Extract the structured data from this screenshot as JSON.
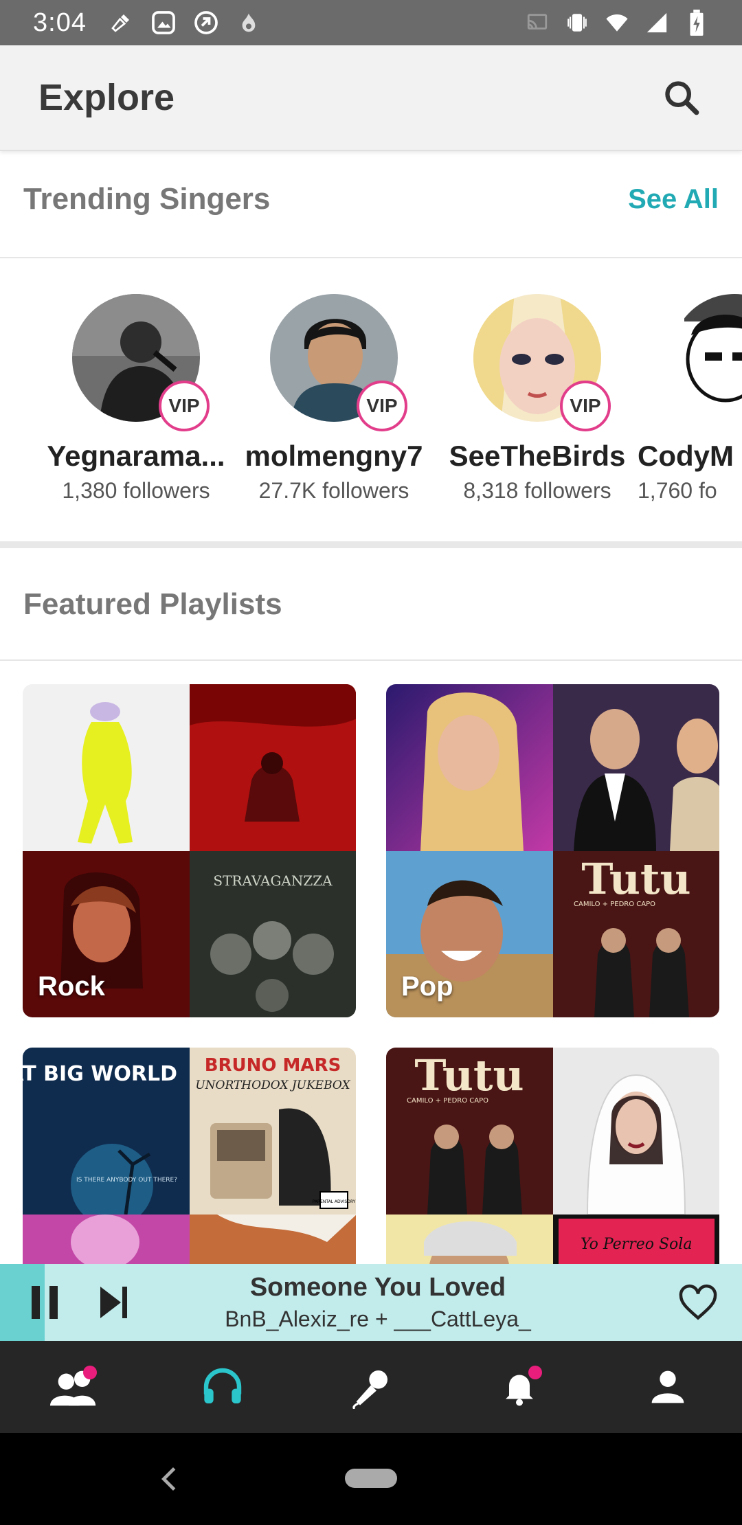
{
  "status_bar": {
    "time": "3:04"
  },
  "app_bar": {
    "title": "Explore",
    "search_icon": "search-icon"
  },
  "trending": {
    "title": "Trending Singers",
    "see_all": "See All",
    "singers": [
      {
        "name": "Yegnarama...",
        "followers": "1,380 followers",
        "badge": "VIP"
      },
      {
        "name": "molmengny7",
        "followers": "27.7K followers",
        "badge": "VIP"
      },
      {
        "name": "SeeTheBirds",
        "followers": "8,318 followers",
        "badge": "VIP"
      },
      {
        "name": "CodyM",
        "followers": "1,760 fo"
      }
    ]
  },
  "featured": {
    "title": "Featured Playlists",
    "playlists": [
      {
        "label": "Rock"
      },
      {
        "label": "Pop"
      },
      {
        "label": ""
      },
      {
        "label": ""
      }
    ],
    "art_text": {
      "stravaganzza": "STRAVAGANZZA",
      "tutu": "Tutu",
      "tutu_sub": "CAMILO + PEDRO CAPO",
      "great_big_world": "A GREAT BIG WORLD",
      "great_big_world_sub": "IS THERE ANYBODY OUT THERE?",
      "bruno_mars": "BRUNO MARS",
      "unorthodox": "UNORTHODOX JUKEBOX",
      "advisory": "PARENTAL ADVISORY",
      "yo_perreo": "Yo Perreo Sola"
    }
  },
  "mini_player": {
    "title": "Someone You Loved",
    "artist": "BnB_Alexiz_re + ___CattLeya_",
    "progress_fraction": 0.06
  },
  "bottom_nav": {
    "items": [
      "people-icon",
      "headphones-icon",
      "microphone-icon",
      "bell-icon",
      "person-icon"
    ]
  },
  "colors": {
    "accent": "#22aab4",
    "vip_border": "#e23d8b",
    "badge_dot": "#e91e7c",
    "player_bg": "#c2ecec"
  }
}
